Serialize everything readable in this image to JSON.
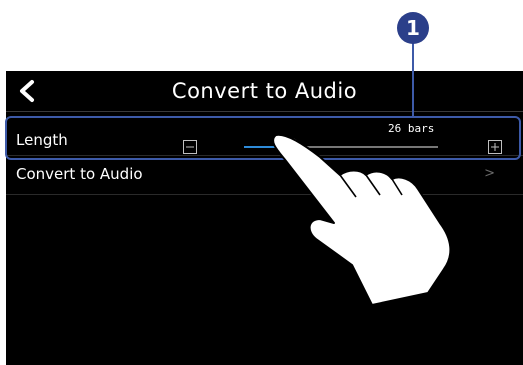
{
  "header": {
    "title": "Convert to Audio",
    "back_icon": "chevron-left-icon"
  },
  "length_row": {
    "label": "Length",
    "value_text": "26 bars",
    "slider_fraction": 0.24,
    "decrement_icon": "minus-box-icon",
    "increment_icon": "plus-box-icon"
  },
  "convert_row": {
    "label": "Convert to Audio",
    "chevron": ">"
  },
  "callout": {
    "number": "1"
  },
  "colors": {
    "screen_bg": "#000000",
    "accent": "#2e8bd9",
    "highlight": "#3d5aa8",
    "badge": "#2b3f8a"
  }
}
